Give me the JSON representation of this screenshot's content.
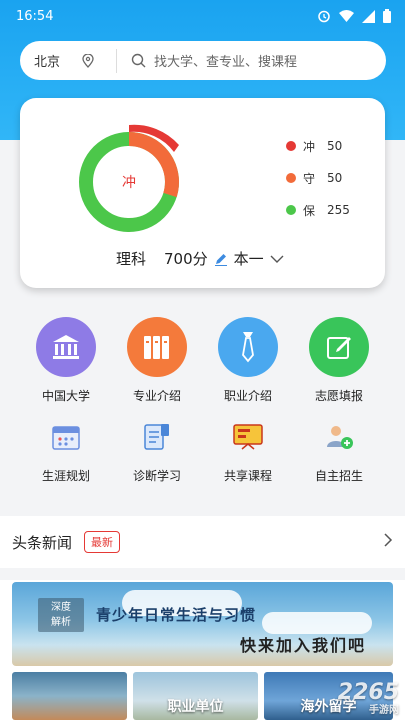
{
  "status_bar": {
    "time": "16:54"
  },
  "search": {
    "city": "北京",
    "placeholder": "找大学、查专业、搜课程"
  },
  "score_card": {
    "center_label": "冲",
    "legend": [
      {
        "label": "冲",
        "count": "50",
        "color": "#e53935"
      },
      {
        "label": "守",
        "count": "50",
        "color": "#f26b3a"
      },
      {
        "label": "保",
        "count": "255",
        "color": "#4cc74a"
      }
    ],
    "subject": "理科",
    "score": "700分",
    "batch": "本一"
  },
  "menu": [
    {
      "label": "中国大学",
      "icon": "university-icon",
      "color": "#8e7be6"
    },
    {
      "label": "专业介绍",
      "icon": "books-icon",
      "color": "#f47a3b"
    },
    {
      "label": "职业介绍",
      "icon": "tie-icon",
      "color": "#4aa8ef"
    },
    {
      "label": "志愿填报",
      "icon": "edit-icon",
      "color": "#39c55a"
    },
    {
      "label": "生涯规划",
      "icon": "calendar-icon"
    },
    {
      "label": "诊断学习",
      "icon": "document-icon"
    },
    {
      "label": "共享课程",
      "icon": "screen-icon"
    },
    {
      "label": "自主招生",
      "icon": "add-user-icon"
    }
  ],
  "news": {
    "title": "头条新闻",
    "badge": "最新"
  },
  "banner": {
    "tag_line1": "深度",
    "tag_line2": "解析",
    "title": "青少年日常生活与习惯",
    "subtitle": "快来加入我们吧"
  },
  "thumbnails": [
    {
      "label": ""
    },
    {
      "label": "职业单位"
    },
    {
      "label": "海外留学"
    }
  ],
  "watermark": {
    "text": "2265",
    "sub": "手游网"
  }
}
